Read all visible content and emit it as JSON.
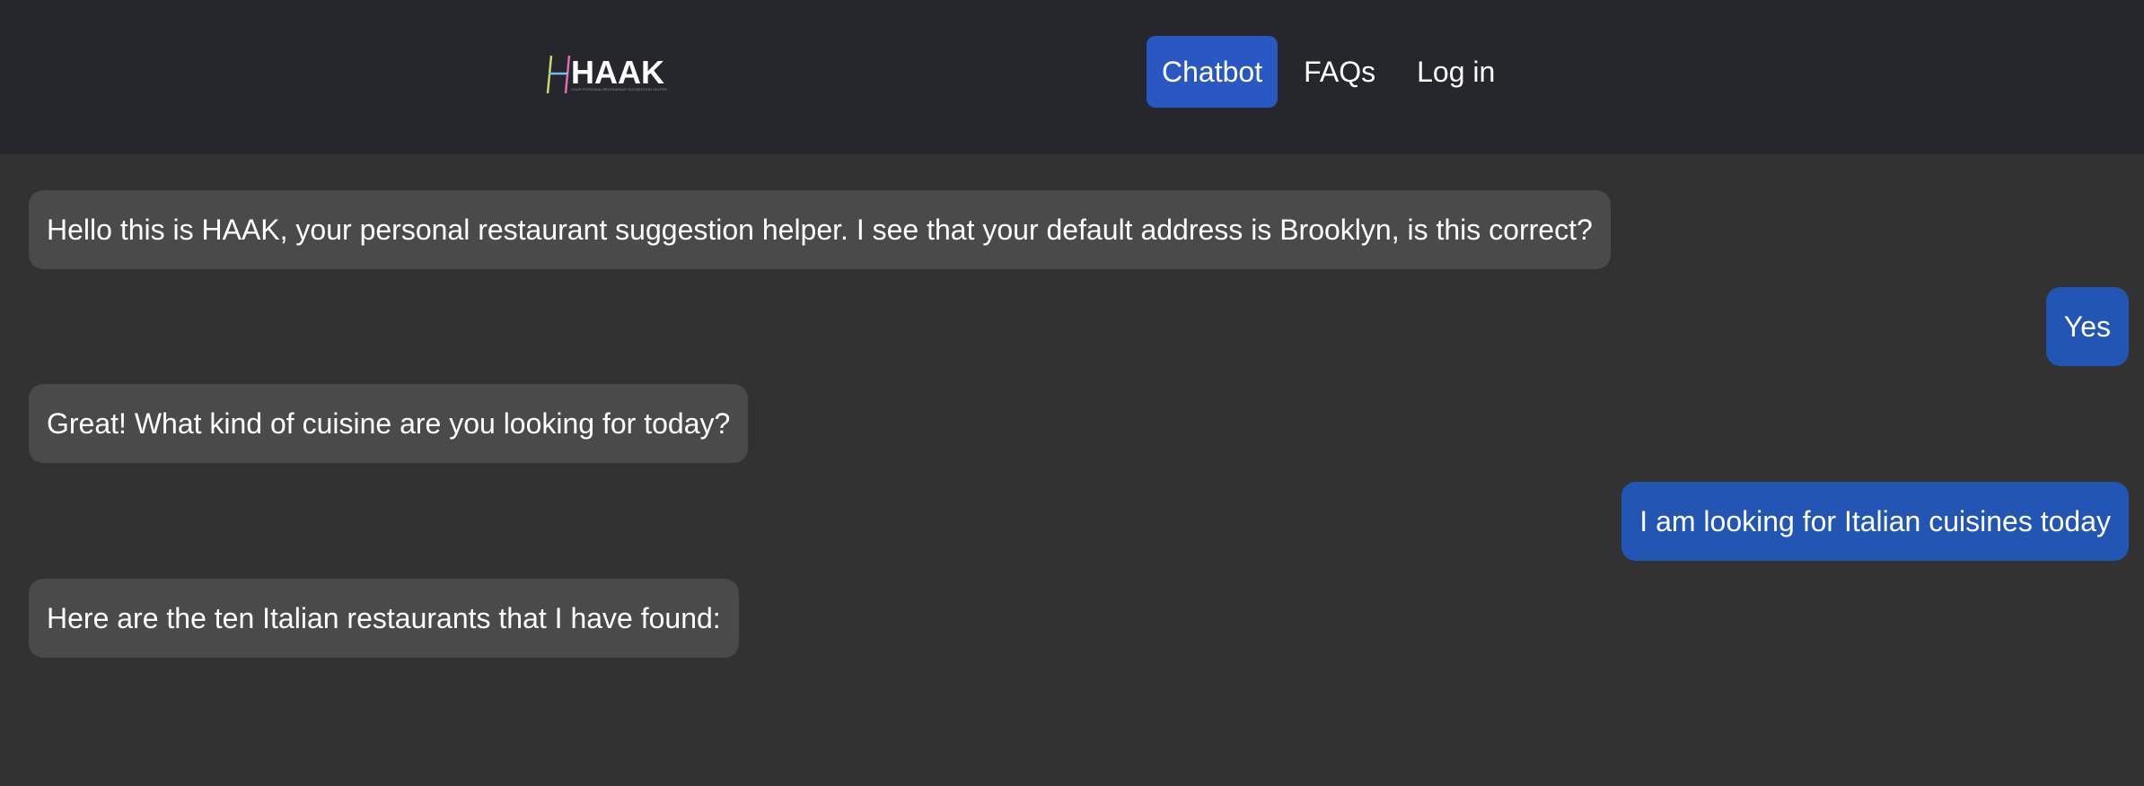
{
  "header": {
    "logo_text": "HAAK",
    "logo_tagline": "YOUR PERSONAL RESTAURANT SUGGESTION HELPER",
    "nav": [
      {
        "label": "Chatbot",
        "active": true
      },
      {
        "label": "FAQs",
        "active": false
      },
      {
        "label": "Log in",
        "active": false
      }
    ]
  },
  "messages": [
    {
      "from": "bot",
      "text": "Hello this is HAAK, your personal restaurant suggestion helper. I see that your default address is Brooklyn, is this correct?"
    },
    {
      "from": "user",
      "text": "Yes"
    },
    {
      "from": "bot",
      "text": "Great! What kind of cuisine are you looking for today?"
    },
    {
      "from": "user",
      "text": "I am looking for Italian cuisines today"
    },
    {
      "from": "bot",
      "text": "Here are the ten Italian restaurants that I have found:"
    }
  ],
  "colors": {
    "header_bg": "#25272c",
    "page_bg": "#323233",
    "bot_bubble": "#4a4a4b",
    "user_bubble": "#2356b4",
    "accent": "#2a58c2"
  }
}
